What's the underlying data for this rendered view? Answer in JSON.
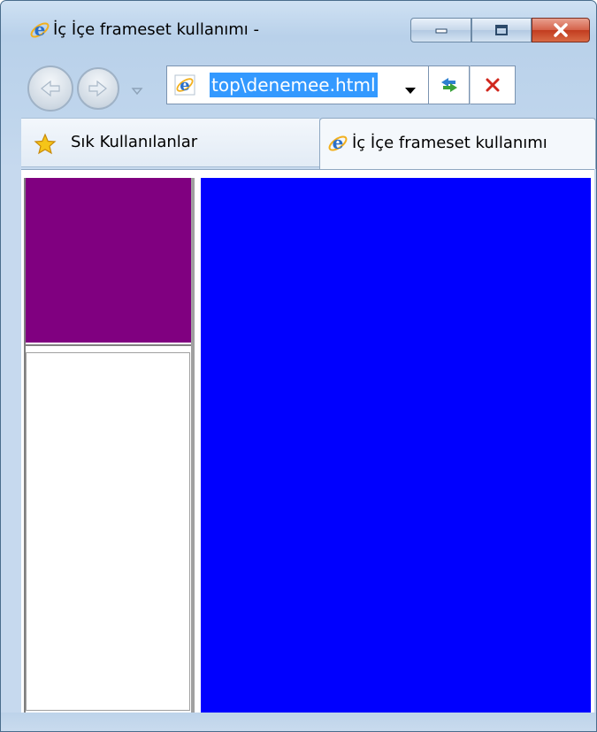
{
  "window": {
    "title": "İç İçe frameset kullanımı -"
  },
  "caption_buttons": [
    "minimize",
    "maximize",
    "close"
  ],
  "navigation": {
    "back_icon": "back-arrow-icon",
    "forward_icon": "forward-arrow-icon",
    "address": "top\\denemee.html",
    "refresh_icon": "refresh-icon",
    "stop_icon": "stop-icon"
  },
  "favorites": {
    "label": "Sık Kullanılanlar"
  },
  "tab": {
    "label": "İç İçe frameset kullanımı"
  },
  "frames": {
    "top_left_color": "#800080",
    "bottom_left_color": "#ffffff",
    "right_color": "#0000ff"
  }
}
